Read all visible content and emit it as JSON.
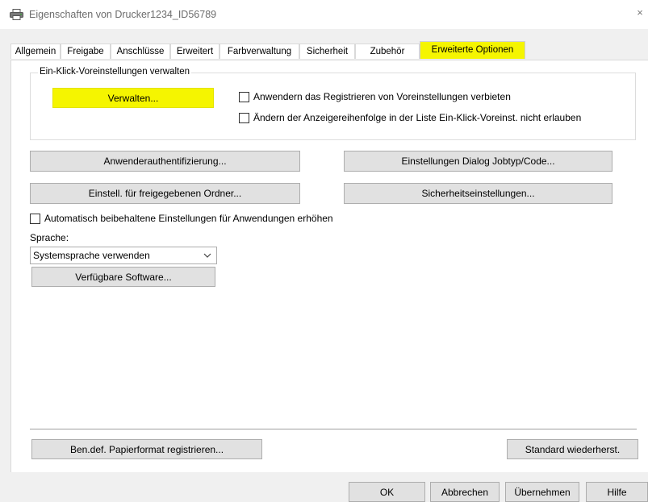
{
  "window": {
    "title": "Eigenschaften von Drucker1234_ID56789",
    "icon": "printer-icon",
    "close": "×"
  },
  "tabs": [
    {
      "label": "Allgemein",
      "active": false
    },
    {
      "label": "Freigabe",
      "active": false
    },
    {
      "label": "Anschlüsse",
      "active": false
    },
    {
      "label": "Erweitert",
      "active": false
    },
    {
      "label": "Farbverwaltung",
      "active": false
    },
    {
      "label": "Sicherheit",
      "active": false
    },
    {
      "label": "Zubehör",
      "active": false
    },
    {
      "label": "Erweiterte Optionen",
      "active": true
    }
  ],
  "one_click": {
    "group_label": "Ein-Klick-Voreinstellungen verwalten",
    "manage_button": "Verwalten...",
    "cb_prevent_register": "Anwendern das Registrieren von Voreinstellungen verbieten",
    "cb_prevent_reorder": "Ändern der Anzeigereihenfolge in der Liste Ein-Klick-Voreinst. nicht erlauben"
  },
  "buttons": {
    "user_auth": "Anwenderauthentifizierung...",
    "job_type": "Einstellungen Dialog Jobtyp/Code...",
    "shared_folder": "Einstell. für freigegebenen Ordner...",
    "security": "Sicherheitseinstellungen...",
    "available_software": "Verfügbare Software...",
    "custom_paper": "Ben.def. Papierformat registrieren...",
    "restore_default": "Standard wiederherst."
  },
  "auto_retain": {
    "label": "Automatisch beibehaltene Einstellungen für Anwendungen erhöhen"
  },
  "language": {
    "label": "Sprache:",
    "selected": "Systemsprache verwenden"
  },
  "dialog_buttons": {
    "ok": "OK",
    "cancel": "Abbrechen",
    "apply": "Übernehmen",
    "help": "Hilfe"
  },
  "colors": {
    "highlight": "#f5f500",
    "button_face": "#e1e1e1",
    "dialog_bg": "#f0f0f0"
  }
}
